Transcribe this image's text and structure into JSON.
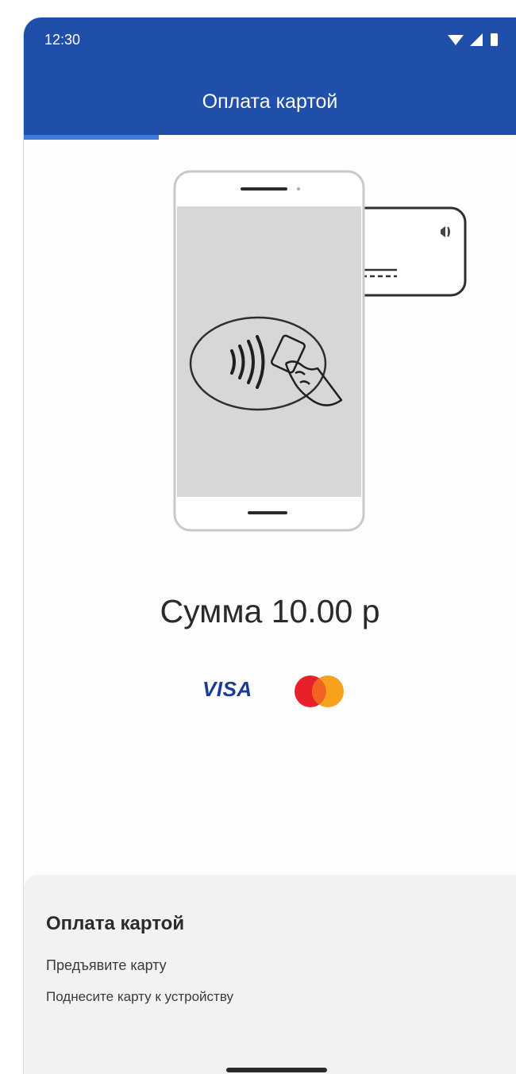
{
  "status_bar": {
    "time": "12:30",
    "icons": [
      "wifi-icon",
      "signal-icon",
      "battery-icon"
    ]
  },
  "header": {
    "title": "Оплата картой",
    "background_color": "#1f4fa8",
    "progress_color": "#3d7be0"
  },
  "illustration": {
    "name": "tap-card-to-phone",
    "contactless_symbol": "contactless-icon"
  },
  "payment": {
    "amount_text": "Сумма 10.00 р",
    "brands": [
      "VISA",
      "mastercard-logo"
    ]
  },
  "bottom_sheet": {
    "title": "Оплата картой",
    "line1": "Предъявите карту",
    "line2": "Поднесите карту к устройству"
  }
}
